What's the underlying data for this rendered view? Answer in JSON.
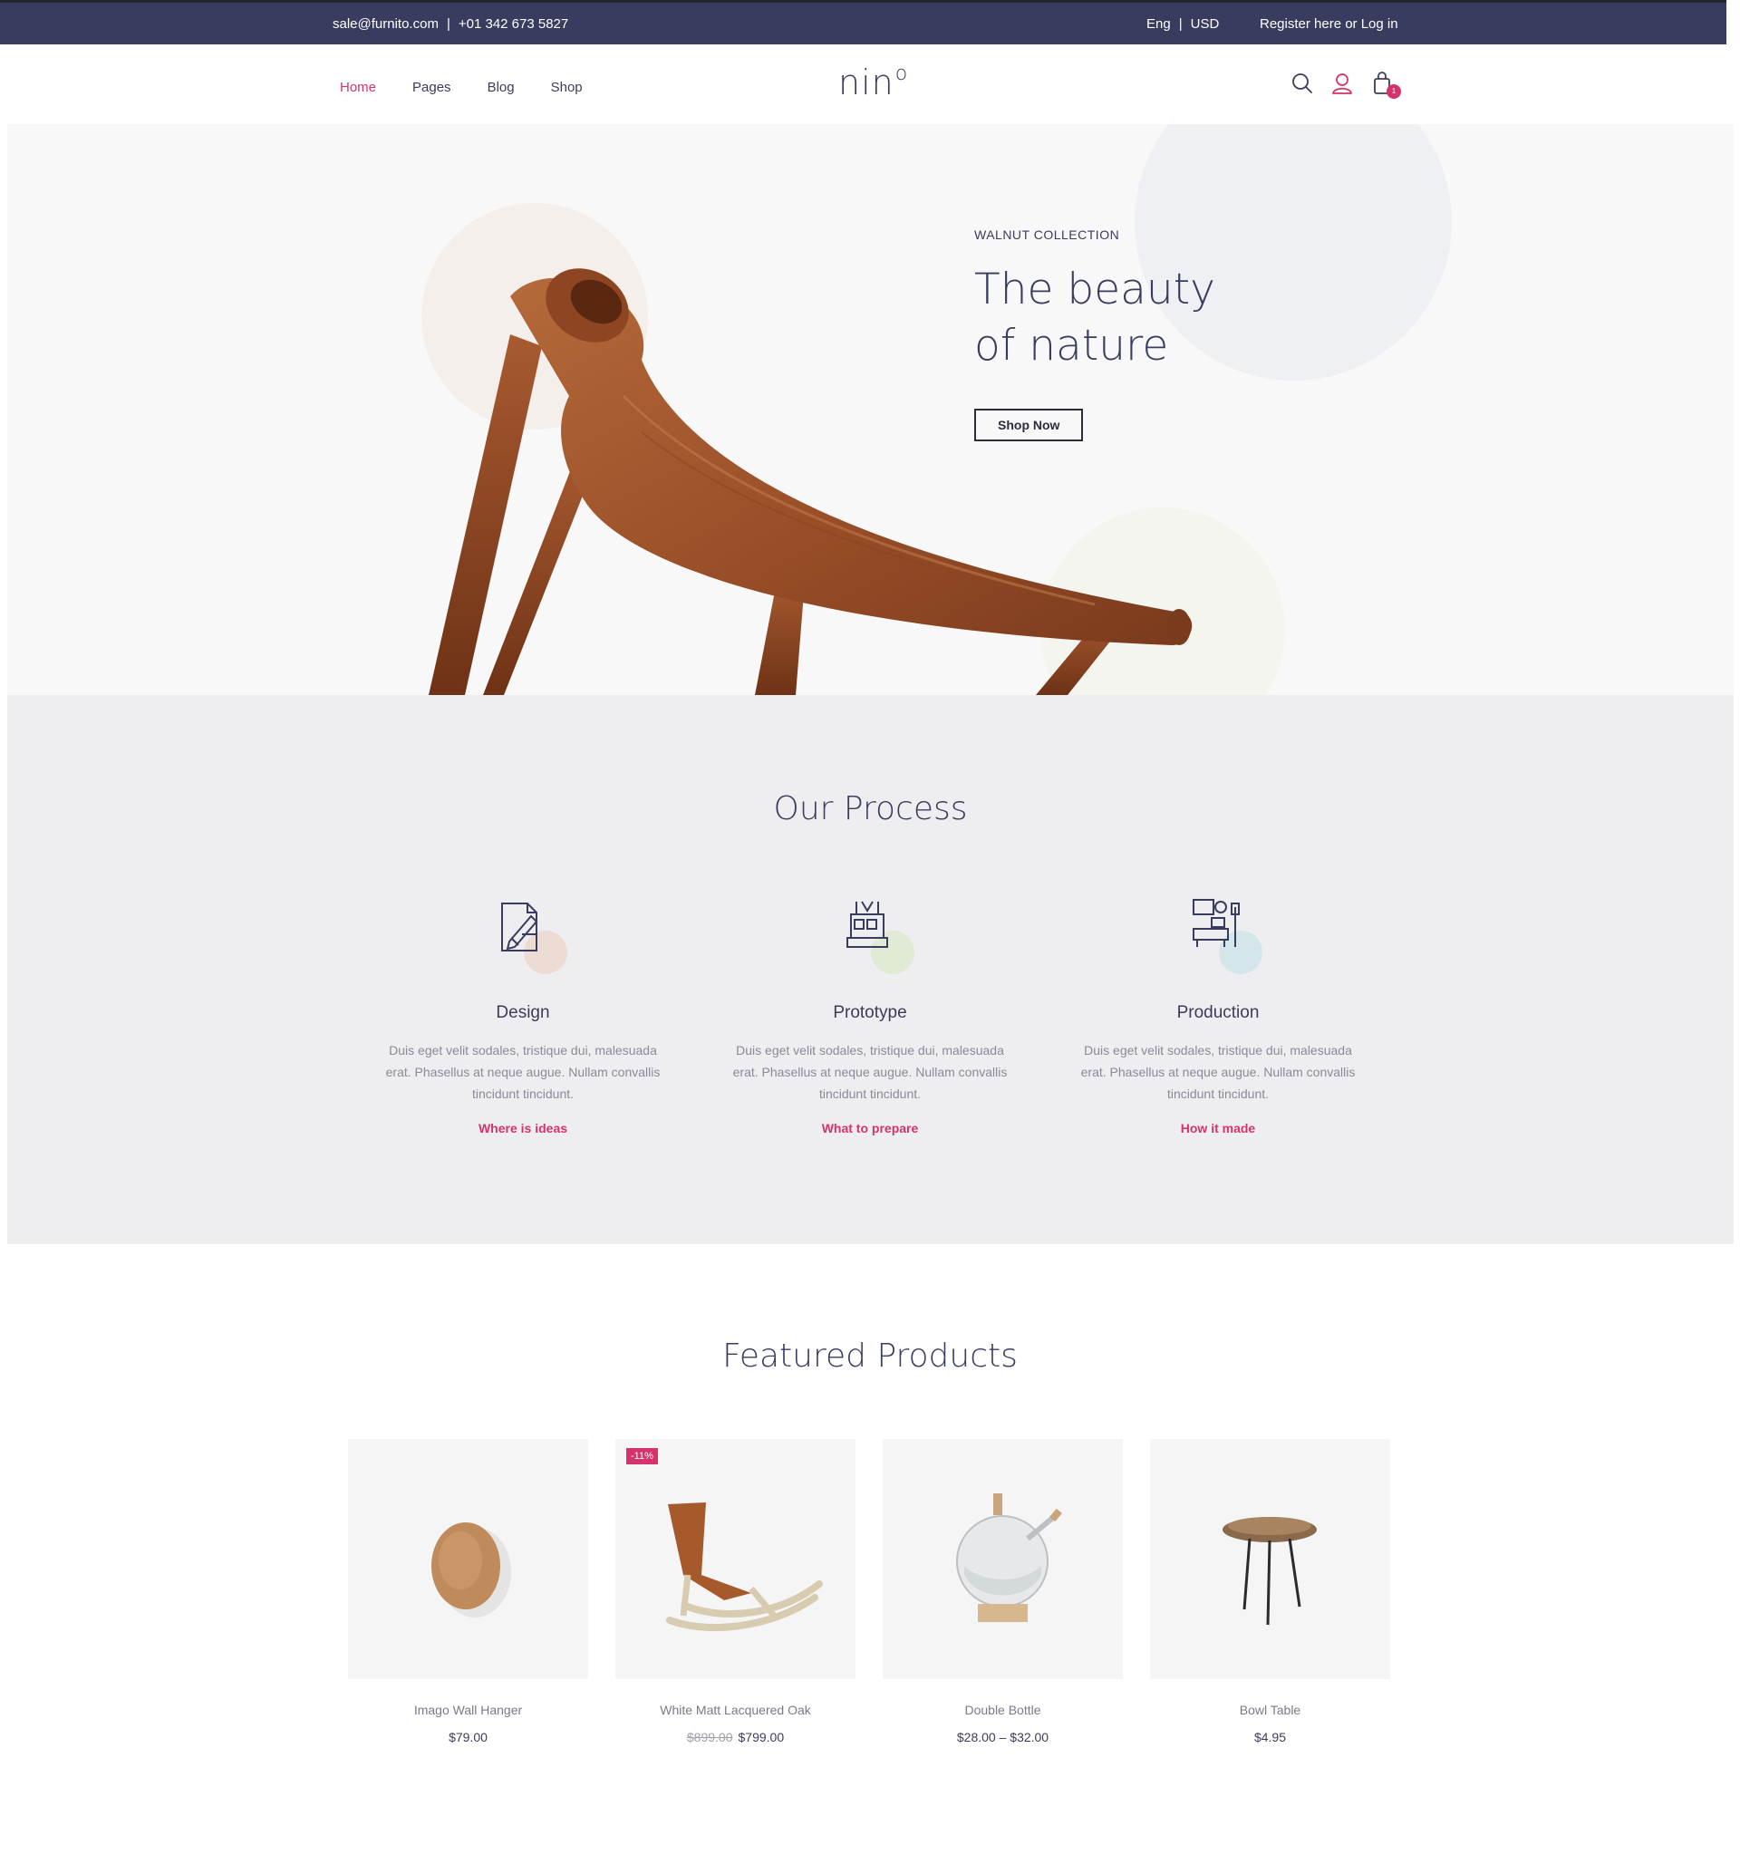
{
  "topbar": {
    "email": "sale@furnito.com",
    "separator": "|",
    "phone": "+01 342 673 5827",
    "language": "Eng",
    "currency": "USD",
    "account_link": "Register here or Log in"
  },
  "header": {
    "nav": [
      "Home",
      "Pages",
      "Blog",
      "Shop"
    ],
    "active_nav": "Home",
    "logo_text": "nin",
    "logo_mark": "o",
    "cart_count": "1",
    "icons": [
      "search-icon",
      "user-icon",
      "shopping-bag-icon"
    ]
  },
  "hero": {
    "eyebrow": "WALNUT COLLECTION",
    "title_line1": "The beauty",
    "title_line2": "of nature",
    "cta": "Shop Now"
  },
  "process": {
    "title": "Our Process",
    "steps": [
      {
        "icon": "design-sketch-icon",
        "title": "Design",
        "text": "Duis eget velit sodales, tristique dui, malesuada erat. Phasellus at neque augue. Nullam convallis tincidunt tincidunt.",
        "link": "Where is ideas",
        "accent": "#ecdcd4"
      },
      {
        "icon": "prototype-workshop-icon",
        "title": "Prototype",
        "text": "Duis eget velit sodales, tristique dui, malesuada erat. Phasellus at neque augue. Nullam convallis tincidunt tincidunt.",
        "link": "What to prepare",
        "accent": "#e0ead4"
      },
      {
        "icon": "production-furniture-icon",
        "title": "Production",
        "text": "Duis eget velit sodales, tristique dui, malesuada erat. Phasellus at neque augue. Nullam convallis tincidunt tincidunt.",
        "link": "How it made",
        "accent": "#d4e6ea"
      }
    ]
  },
  "featured": {
    "title": "Featured Products",
    "products": [
      {
        "name": "Imago Wall Hanger",
        "price": "$79.00",
        "old_price": "",
        "badge": ""
      },
      {
        "name": "White Matt Lacquered Oak",
        "price": "$799.00",
        "old_price": "$899.00",
        "badge": "-11%"
      },
      {
        "name": "Double Bottle",
        "price": "$28.00 – $32.00",
        "old_price": "",
        "badge": ""
      },
      {
        "name": "Bowl Table",
        "price": "$4.95",
        "old_price": "",
        "badge": ""
      }
    ]
  },
  "colors": {
    "topbar": "#383c5e",
    "accent": "#d6336c",
    "text_dark": "#383c5e",
    "process_bg": "#eeeef0",
    "hero_bg": "#f8f8f8"
  }
}
